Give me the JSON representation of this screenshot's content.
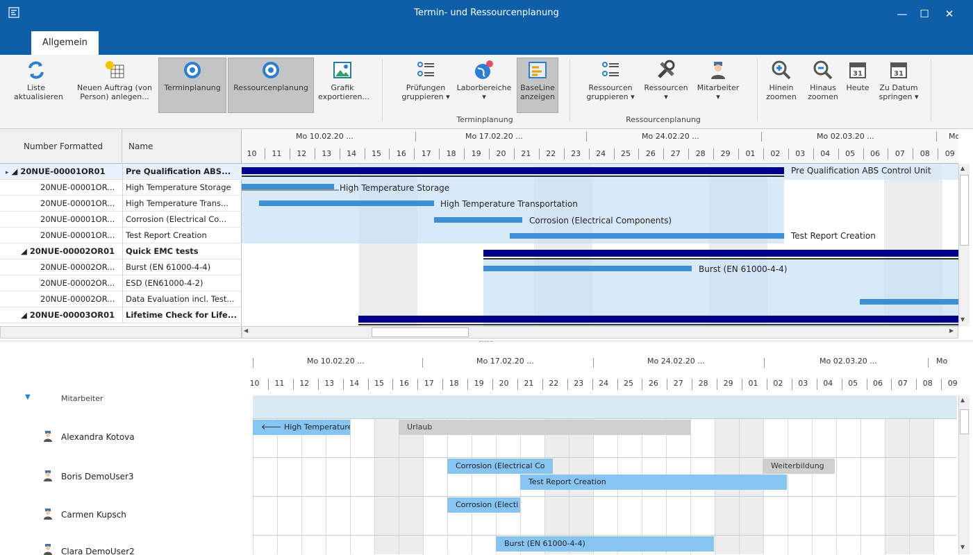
{
  "window": {
    "title": "Termin- und Ressourcenplanung",
    "minimize": "—",
    "maximize": "☐",
    "close": "✕"
  },
  "tabs": [
    {
      "label": "Allgemein"
    }
  ],
  "ribbon": {
    "buttons": [
      {
        "label": "Liste\naktualisieren"
      },
      {
        "label": "Neuen Auftrag (von\nPerson) anlegen..."
      },
      {
        "label": "Terminplanung"
      },
      {
        "label": "Ressourcenplanung"
      },
      {
        "label": "Grafik\nexportieren..."
      },
      {
        "label": "Prüfungen\ngruppieren ▾"
      },
      {
        "label": "Laborbereiche\n▾"
      },
      {
        "label": "BaseLine\nanzeigen"
      },
      {
        "label": "Ressourcen\ngruppieren ▾"
      },
      {
        "label": "Ressourcen\n▾"
      },
      {
        "label": "Mitarbeiter\n▾"
      },
      {
        "label": "Hinein\nzoomen"
      },
      {
        "label": "Hinaus\nzoomen"
      },
      {
        "label": "Heute"
      },
      {
        "label": "Zu Datum\nspringen ▾"
      }
    ],
    "groups": [
      {
        "label": "Terminplanung"
      },
      {
        "label": "Ressourcenplanung"
      }
    ],
    "calendar_day": "31"
  },
  "grid": {
    "headers": [
      "Number Formatted",
      "Name"
    ],
    "rows": [
      {
        "number": "◢ 20NUE-00001OR01",
        "name": "Pre Qualification ABS..."
      },
      {
        "number": "20NUE-00001OR...",
        "name": "High Temperature Storage"
      },
      {
        "number": "20NUE-00001OR...",
        "name": "High Temperature Trans..."
      },
      {
        "number": "20NUE-00001OR...",
        "name": "Corrosion (Electrical Co..."
      },
      {
        "number": "20NUE-00001OR...",
        "name": "Test Report Creation"
      },
      {
        "number": "◢ 20NUE-00002OR01",
        "name": "Quick EMC tests"
      },
      {
        "number": "20NUE-00002OR...",
        "name": "Burst (EN 61000-4-4)"
      },
      {
        "number": "20NUE-00002OR...",
        "name": "ESD (EN61000-4-2)"
      },
      {
        "number": "20NUE-00002OR...",
        "name": "Data Evaluation incl. Test..."
      },
      {
        "number": "◢ 20NUE-00003OR01",
        "name": "Lifetime Check for Life..."
      }
    ]
  },
  "timeline": {
    "weeks": [
      "Mo 10.02.20 ...",
      "Mo 17.02.20 ...",
      "Mo 24.02.20 ...",
      "Mo 02.03.20 ...",
      "Mo 0"
    ],
    "weeks_bottom": [
      "Mo 10.02.20 ...",
      "Mo 17.02.20 ...",
      "Mo 24.02.20 ...",
      "Mo 02.03.20 ...",
      "Mo"
    ],
    "days": [
      "10",
      "11",
      "12",
      "13",
      "14",
      "15",
      "16",
      "17",
      "18",
      "19",
      "20",
      "21",
      "22",
      "23",
      "24",
      "25",
      "26",
      "27",
      "28",
      "29",
      "01",
      "02",
      "03",
      "04",
      "05",
      "06",
      "07",
      "08",
      "09"
    ]
  },
  "tasks": [
    {
      "label": "Pre Qualification ABS Control Unit"
    },
    {
      "label": "High Temperature Storage"
    },
    {
      "label": "High Temperature Transportation"
    },
    {
      "label": "Corrosion (Electrical Components)"
    },
    {
      "label": "Test Report Creation"
    },
    {
      "label": "Burst (EN 61000-4-4)"
    }
  ],
  "resources": {
    "group": "Mitarbeiter",
    "people": [
      {
        "name": "Alexandra Kotova"
      },
      {
        "name": "Boris DemoUser3"
      },
      {
        "name": "Carmen Kupsch"
      },
      {
        "name": "Clara DemoUser2"
      }
    ],
    "bars": [
      {
        "label": "🡐 High Temperature"
      },
      {
        "label": "Urlaub"
      },
      {
        "label": "Corrosion (Electrical Co"
      },
      {
        "label": "Weiterbildung"
      },
      {
        "label": "Test Report Creation"
      },
      {
        "label": "Corrosion (Electi"
      },
      {
        "label": "Burst (EN 61000-4-4)"
      }
    ]
  }
}
